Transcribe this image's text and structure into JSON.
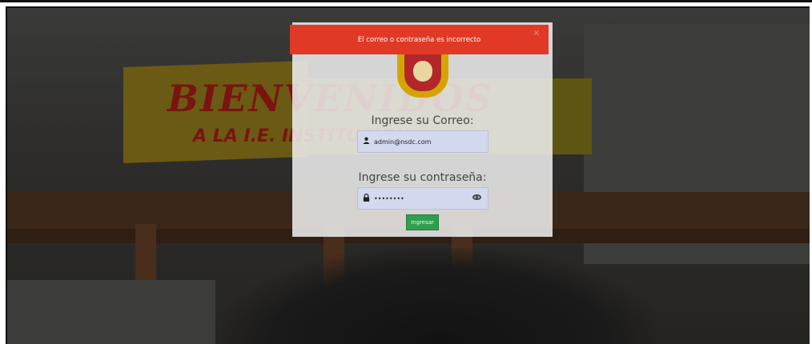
{
  "alert": {
    "message": "El correo o contraseña es incorrecto",
    "close_symbol": "×"
  },
  "login": {
    "email_label": "Ingrese su Correo:",
    "email_value": "admin@nsdc.com",
    "password_label": "Ingrese su contraseña:",
    "password_value": "••••••••",
    "submit_label": "Ingresar"
  },
  "background": {
    "banner_line1": "BIENVENIDOS",
    "banner_line2": "A LA I.E. INSTITUCIÓN"
  },
  "colors": {
    "alert_bg": "#e03a27",
    "button_bg": "#2f9e4f",
    "input_bg": "#d3d9ef"
  },
  "icons": {
    "email": "user-icon",
    "password": "lock-icon",
    "toggle": "eye-icon",
    "close": "close-icon"
  }
}
